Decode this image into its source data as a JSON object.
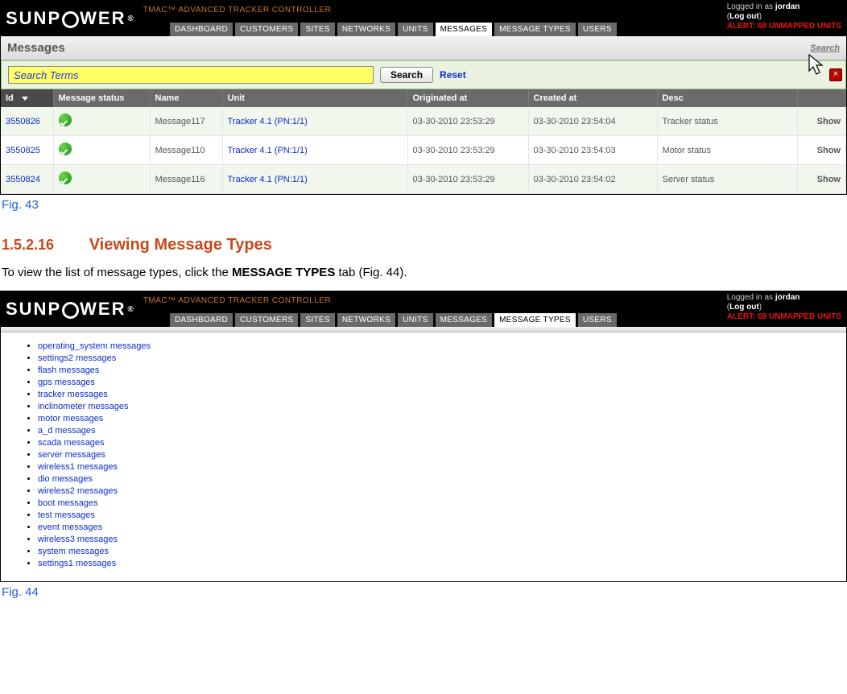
{
  "brand": {
    "name_left": "SUNP",
    "name_right": "WER",
    "reg": "®",
    "tmac": "TMAC™ ADVANCED TRACKER CONTROLLER"
  },
  "user": {
    "logged_prefix": "Logged in as ",
    "username": "jordan",
    "logout_open": "(",
    "logout_label": "Log out",
    "logout_close": ")",
    "alert": "ALERT: 68 UNMAPPED UNITS"
  },
  "nav": {
    "dashboard": "DASHBOARD",
    "customers": "CUSTOMERS",
    "sites": "SITES",
    "networks": "NETWORKS",
    "units": "UNITS",
    "messages": "MESSAGES",
    "message_types": "MESSAGE TYPES",
    "users": "USERS"
  },
  "messages_panel": {
    "title": "Messages",
    "search_link": "Search",
    "search_placeholder": "Search Terms",
    "search_button": "Search",
    "reset": "Reset",
    "close": "×",
    "columns": {
      "id": "Id",
      "status": "Message status",
      "name": "Name",
      "unit": "Unit",
      "originated": "Originated at",
      "created": "Created at",
      "desc": "Desc",
      "actions": ""
    },
    "rows": [
      {
        "id": "3550826",
        "name": "Message117",
        "unit": "Tracker 4.1 (PN:1/1)",
        "originated": "03-30-2010 23:53:29",
        "created": "03-30-2010 23:54:04",
        "desc": "Tracker status",
        "action": "Show"
      },
      {
        "id": "3550825",
        "name": "Message110",
        "unit": "Tracker 4.1 (PN:1/1)",
        "originated": "03-30-2010 23:53:29",
        "created": "03-30-2010 23:54:03",
        "desc": "Motor status",
        "action": "Show"
      },
      {
        "id": "3550824",
        "name": "Message116",
        "unit": "Tracker 4.1 (PN:1/1)",
        "originated": "03-30-2010 23:53:29",
        "created": "03-30-2010 23:54:02",
        "desc": "Server status",
        "action": "Show"
      }
    ]
  },
  "caption1": "Fig. 43",
  "section": {
    "number": "1.5.2.16",
    "title": "Viewing Message Types",
    "body_prefix": "To view the list of message types, click the ",
    "body_bold": "MESSAGE TYPES",
    "body_suffix": " tab (Fig. 44)."
  },
  "mt": {
    "items": [
      "operating_system messages",
      "settings2 messages",
      "flash messages",
      "gps messages",
      "tracker messages",
      "inclinometer messages",
      "motor messages",
      "a_d messages",
      "scada messages",
      "server messages",
      "wireless1 messages",
      "dio messages",
      "wireless2 messages",
      "boot messages",
      "test messages",
      "event messages",
      "wireless3 messages",
      "system messages",
      "settings1 messages"
    ]
  },
  "caption2": "Fig. 44"
}
